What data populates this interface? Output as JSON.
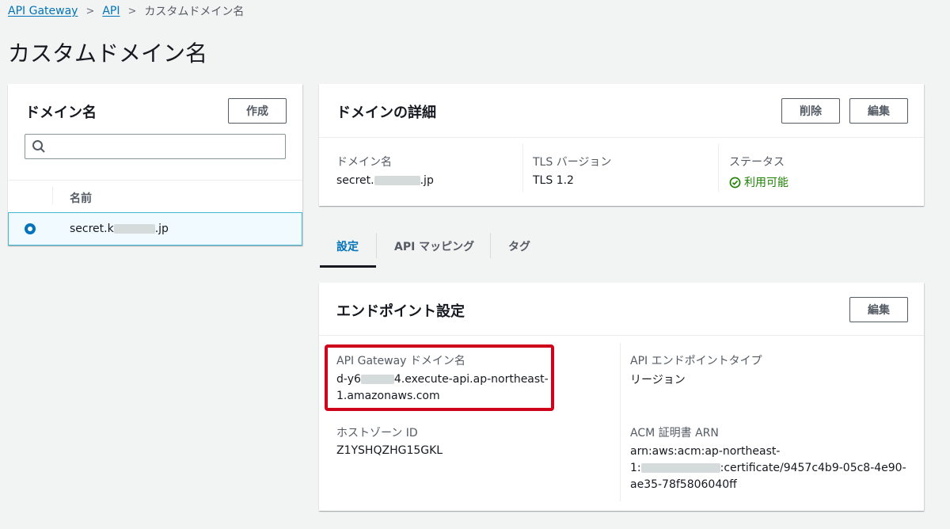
{
  "breadcrumb": {
    "root": "API Gateway",
    "api": "API",
    "current": "カスタムドメイン名"
  },
  "page": {
    "title": "カスタムドメイン名"
  },
  "domains": {
    "heading": "ドメイン名",
    "create_label": "作成",
    "search_placeholder": "",
    "column_name": "名前",
    "rows": [
      {
        "prefix": "secret.k",
        "suffix": ".jp",
        "selected": true
      }
    ]
  },
  "details": {
    "heading": "ドメインの詳細",
    "delete_label": "削除",
    "edit_label": "編集",
    "domain_label": "ドメイン名",
    "domain_prefix": "secret.",
    "domain_suffix": ".jp",
    "tls_label": "TLS バージョン",
    "tls_value": "TLS 1.2",
    "status_label": "ステータス",
    "status_value": "利用可能",
    "status_color": "#1d8102"
  },
  "tabs": [
    {
      "label": "設定"
    },
    {
      "label": "API マッピング"
    },
    {
      "label": "タグ"
    }
  ],
  "endpoint": {
    "heading": "エンドポイント設定",
    "edit_label": "編集",
    "gw_domain_label": "API Gateway ドメイン名",
    "gw_domain_prefix": "d-y6",
    "gw_domain_mid": "4.execute-api.ap-northeast-",
    "gw_domain_line2": "1.amazonaws.com",
    "type_label": "API エンドポイントタイプ",
    "type_value": "リージョン",
    "zone_label": "ホストゾーン ID",
    "zone_value": "Z1YSHQZHG15GKL",
    "acm_label": "ACM 証明書 ARN",
    "acm_line1": "arn:aws:acm:ap-northeast-",
    "acm_line2_prefix": "1:",
    "acm_line2_suffix": ":certificate/9457c4b9-05c8-4e90-",
    "acm_line3": "ae35-78f5806040ff"
  },
  "colors": {
    "link": "#0073bb",
    "highlight": "#d0021b",
    "selected_row": "#f1faff"
  }
}
